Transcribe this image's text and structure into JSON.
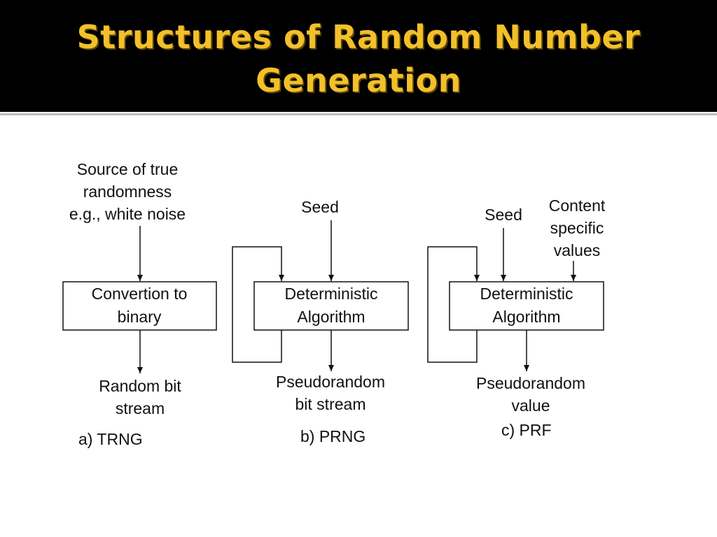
{
  "title": {
    "line1": "Structures of Random Number",
    "line2": "Generation"
  },
  "colors": {
    "title_bar": "#000000",
    "title_text": "#f2c02a",
    "diagram_ink": "#111111",
    "background": "#ffffff"
  },
  "trng": {
    "input_lines": [
      "Source of true",
      "randomness",
      "e.g., white noise"
    ],
    "box_lines": [
      "Convertion to",
      "binary"
    ],
    "output_lines": [
      "Random bit",
      "stream"
    ],
    "caption": "a) TRNG"
  },
  "prng": {
    "seed_label": "Seed",
    "box_lines": [
      "Deterministic",
      "Algorithm"
    ],
    "output_lines": [
      "Pseudorandom",
      "bit stream"
    ],
    "caption": "b) PRNG"
  },
  "prf": {
    "seed_label": "Seed",
    "context_lines": [
      "Content",
      "specific",
      "values"
    ],
    "box_lines": [
      "Deterministic",
      "Algorithm"
    ],
    "output_lines": [
      "Pseudorandom",
      "value"
    ],
    "caption": "c) PRF"
  }
}
